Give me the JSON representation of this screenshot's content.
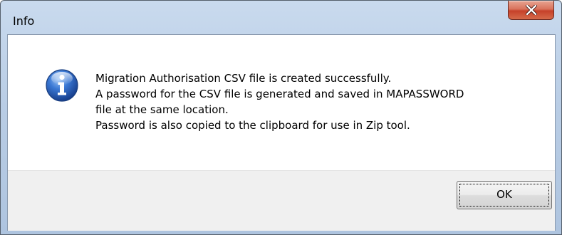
{
  "window": {
    "title": "Info"
  },
  "titlebar": {
    "close_glyph": "X",
    "close_icon": "close-icon"
  },
  "message": {
    "icon": "info-icon",
    "lines": [
      "Migration Authorisation CSV file is created successfully.",
      "A password for the CSV file is generated and saved in MAPASSWORD",
      "file at the same location.",
      "Password is also copied to the clipboard for use in Zip tool."
    ]
  },
  "buttons": {
    "ok_label": "OK"
  },
  "colors": {
    "frame": "#b9cde5",
    "close_button": "#c6412a",
    "icon_blue": "#2a5fb0",
    "button_area": "#f0f0f0"
  }
}
